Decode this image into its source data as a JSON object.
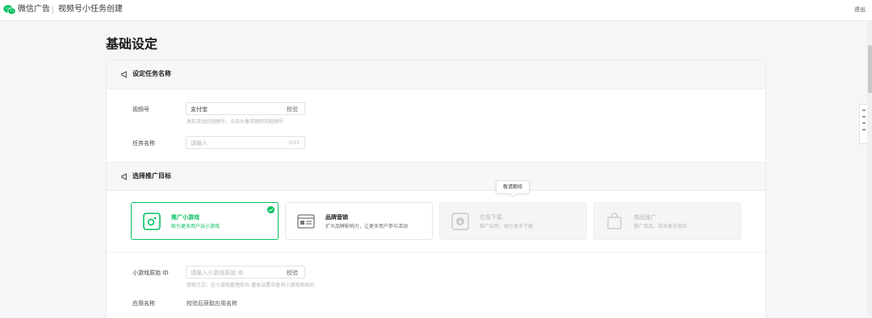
{
  "topbar": {
    "brand": "微信广告",
    "page_name": "视频号小任务创建",
    "logout": "退出"
  },
  "heading": "基础设定",
  "section1": {
    "title": "设定任务名称",
    "channel_label": "视频号",
    "channel_value": "支付宝",
    "verify": "校验",
    "channel_hint": "发布活动的视频号，点击头像可跳转到视频号",
    "task_label": "任务名称",
    "task_placeholder": "请输入",
    "task_count": "0/15"
  },
  "section2": {
    "title": "选择推广目标",
    "tooltip": "敬请期待",
    "goals": [
      {
        "title": "推广小游戏",
        "desc": "吸引更多用户玩小游戏",
        "state": "selected"
      },
      {
        "title": "品牌营销",
        "desc": "扩大品牌影响力，让更多用户参与活动",
        "state": "normal"
      },
      {
        "title": "应用下载",
        "desc": "推广应用，吸引更多下载",
        "state": "disabled"
      },
      {
        "title": "商品推广",
        "desc": "推广商品，带来更多购买",
        "state": "disabled"
      }
    ],
    "game_id_label": "小游戏原始 ID",
    "game_id_placeholder": "请输入小游戏原始 ID",
    "verify": "校验",
    "game_id_hint": "获取方式：在小游戏管理后台-基本设置中查询小游戏原始ID",
    "app_name_label": "应用名称",
    "app_name_value": "校验后获取应用名称"
  },
  "colors": {
    "accent": "#07c160",
    "background": "#f5f6f7",
    "card": "#ffffff"
  },
  "icons": [
    "wechat-logo-icon",
    "megaphone-icon",
    "game-icon",
    "browser-icon",
    "download-icon",
    "shopping-bag-icon",
    "check-icon"
  ]
}
